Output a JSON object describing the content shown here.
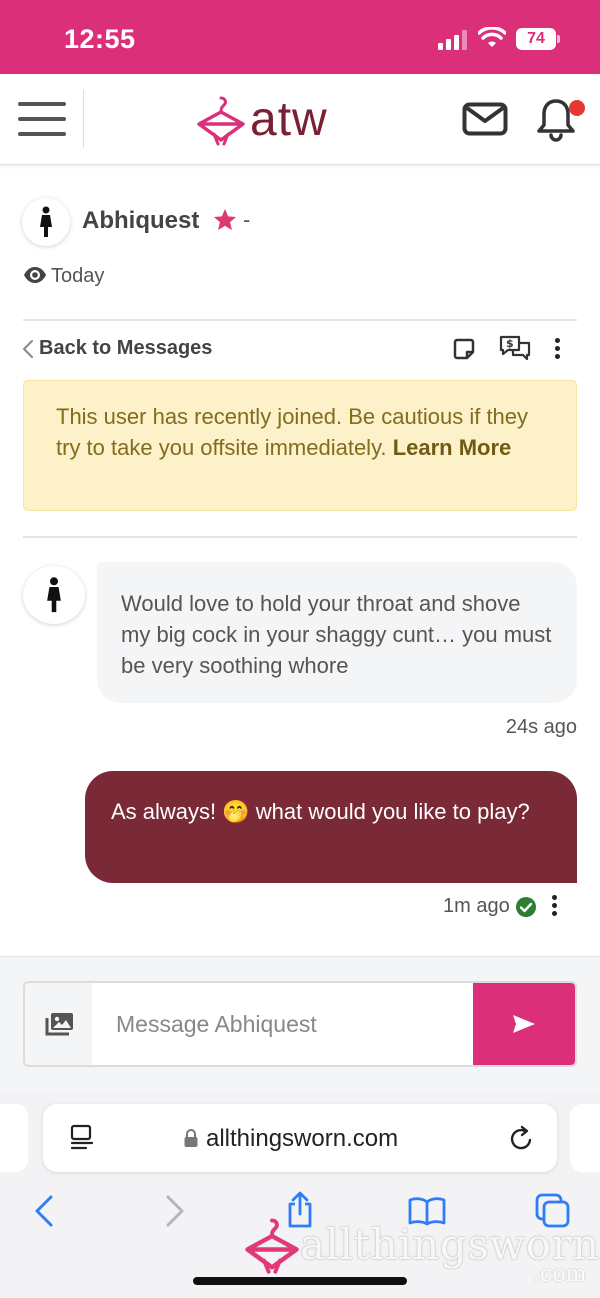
{
  "status_bar": {
    "time": "12:55",
    "battery": "74",
    "bg_color": "#dc2f7a"
  },
  "header": {
    "logo_text": "atw",
    "menu_icon": "hamburger-icon",
    "mail_icon": "mail-icon",
    "bell_icon": "bell-icon",
    "has_notification": true,
    "brand_color": "#7b2034"
  },
  "conversation": {
    "username": "Abhiquest",
    "separator": "-",
    "last_seen": "Today",
    "back_label": "Back to Messages",
    "warning": {
      "text": "This user has recently joined. Be cautious if they try to take you offsite immediately.",
      "link": "Learn More"
    }
  },
  "messages": [
    {
      "direction": "incoming",
      "text": "Would love to hold your throat and shove my big cock in your shaggy cunt… you must be very soothing whore",
      "time": "24s ago"
    },
    {
      "direction": "outgoing",
      "text": "As always! 🤭 what would you like to play?",
      "time": "1m ago",
      "status": "delivered"
    }
  ],
  "composer": {
    "placeholder": "Message Abhiquest",
    "send_color": "#dc2f7a"
  },
  "browser": {
    "url": "allthingsworn.com",
    "watermark": "allthingsworn",
    "watermark_suffix": ".com"
  }
}
